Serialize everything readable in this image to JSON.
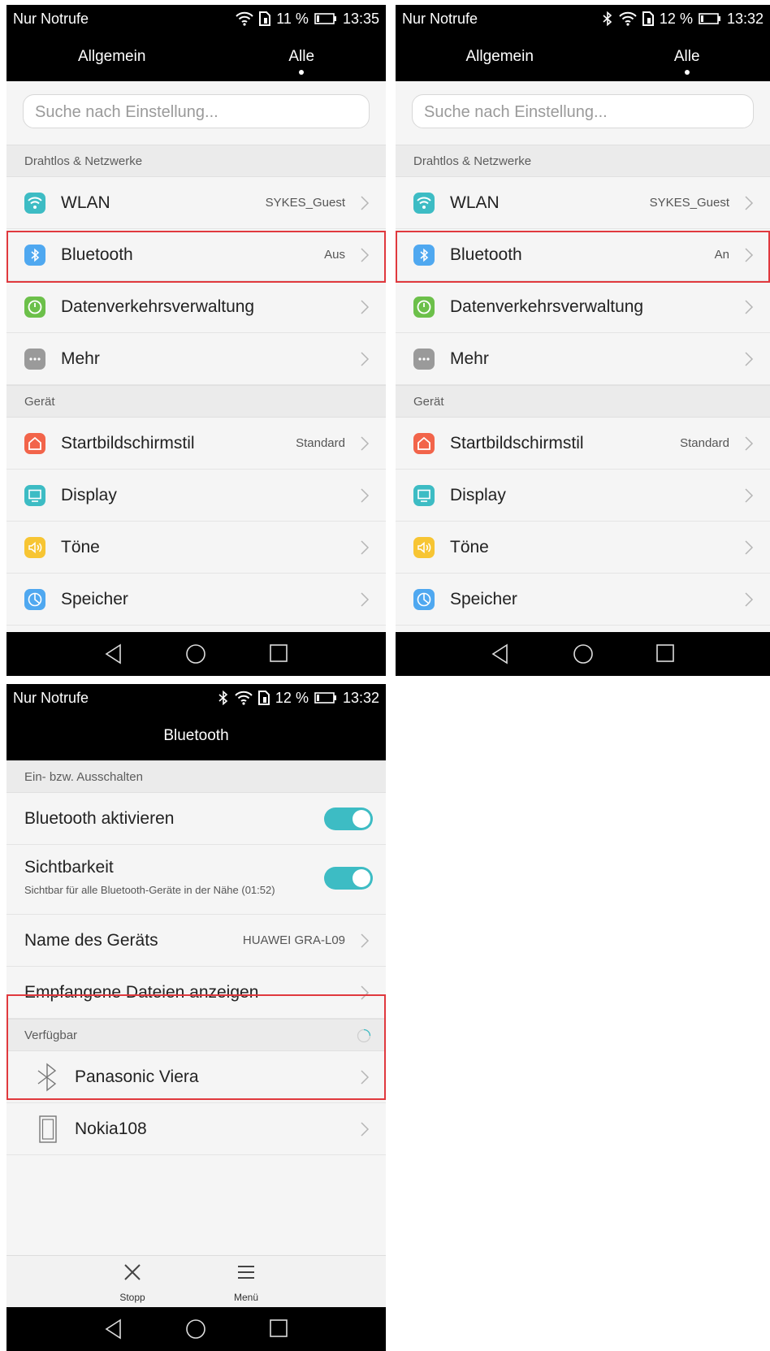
{
  "status_a": {
    "carrier": "Nur Notrufe",
    "battery": "11 %",
    "time": "13:35"
  },
  "status_b": {
    "carrier": "Nur Notrufe",
    "battery": "12 %",
    "time": "13:32"
  },
  "status_c": {
    "carrier": "Nur Notrufe",
    "battery": "12 %",
    "time": "13:32"
  },
  "tabs": {
    "general": "Allgemein",
    "all": "Alle"
  },
  "search": {
    "placeholder": "Suche nach Einstellung..."
  },
  "sections": {
    "wireless": "Drahtlos & Netzwerke",
    "device": "Gerät"
  },
  "settings": {
    "wlan": {
      "label": "WLAN",
      "value": "SYKES_Guest"
    },
    "bluetooth": {
      "label": "Bluetooth",
      "value_off": "Aus",
      "value_on": "An"
    },
    "data": {
      "label": "Datenverkehrsverwaltung"
    },
    "more": {
      "label": "Mehr"
    },
    "home": {
      "label": "Startbildschirmstil",
      "value": "Standard"
    },
    "display": {
      "label": "Display"
    },
    "sounds": {
      "label": "Töne"
    },
    "storage": {
      "label": "Speicher"
    }
  },
  "bt_screen": {
    "title": "Bluetooth",
    "section_power": "Ein- bzw. Ausschalten",
    "enable": "Bluetooth aktivieren",
    "visibility": "Sichtbarkeit",
    "visibility_sub": "Sichtbar für alle Bluetooth-Geräte in der Nähe (01:52)",
    "device_name_label": "Name des Geräts",
    "device_name_value": "HUAWEI GRA-L09",
    "received_files": "Empfangene Dateien anzeigen",
    "section_available": "Verfügbar",
    "devices": [
      {
        "name": "Panasonic Viera"
      },
      {
        "name": "Nokia108"
      }
    ],
    "stop": "Stopp",
    "menu": "Menü"
  },
  "colors": {
    "accent": "#3dbcc4",
    "highlight": "#e0393e",
    "wlan_icon": "#3dbcc4",
    "bt_icon": "#4fa8f0",
    "data_icon": "#6cc04a",
    "more_icon": "#9a9a9a",
    "home_icon": "#f2644a",
    "display_icon": "#3dbcc4",
    "sounds_icon": "#f7c533",
    "storage_icon": "#4fa8f0"
  }
}
